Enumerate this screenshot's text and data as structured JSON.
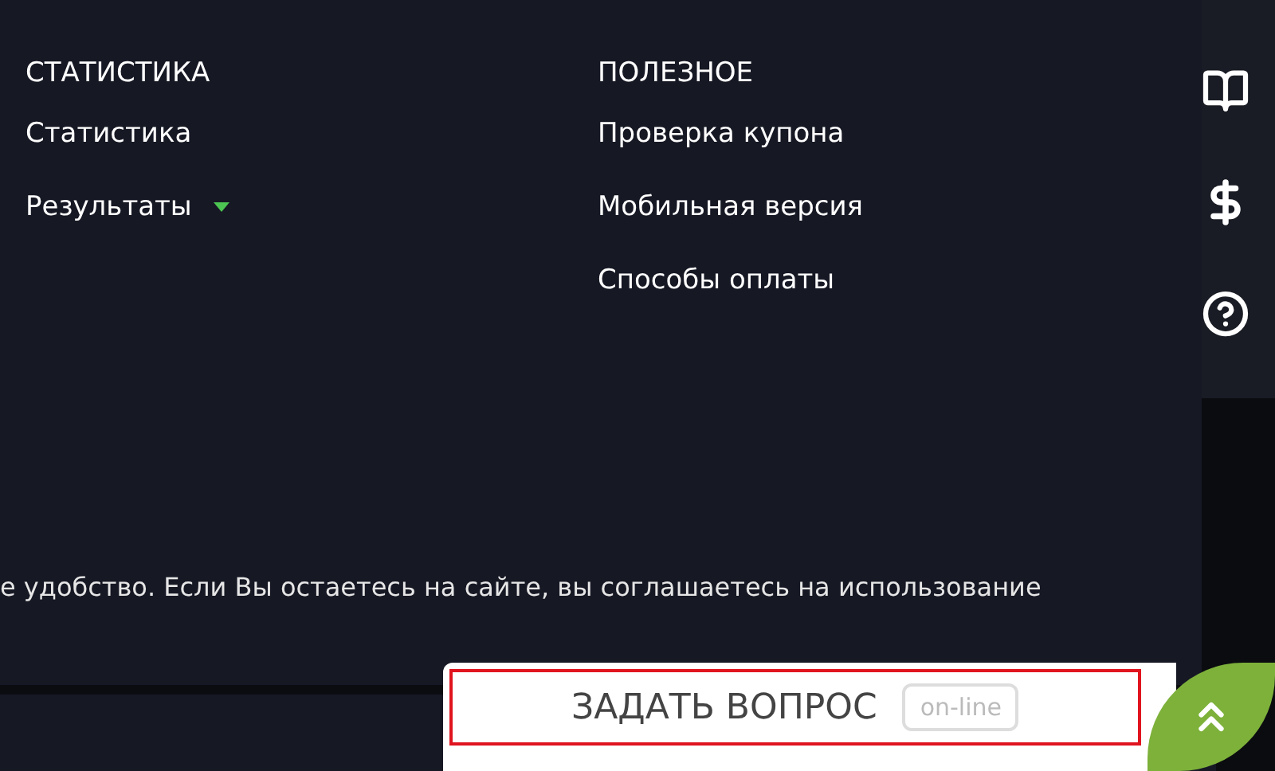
{
  "footer_columns": [
    {
      "heading": "СТАТИСТИКА",
      "links": [
        {
          "label": "Статистика",
          "kind": "plain"
        },
        {
          "label": "Результаты",
          "kind": "dropdown"
        }
      ]
    },
    {
      "heading": "ПОЛЕЗНОЕ",
      "links": [
        {
          "label": "Проверка купона",
          "kind": "plain"
        },
        {
          "label": "Мобильная версия",
          "kind": "plain"
        },
        {
          "label": "Способы оплаты",
          "kind": "plain"
        }
      ]
    }
  ],
  "side_icons": [
    {
      "kind": "book"
    },
    {
      "kind": "dollar"
    },
    {
      "kind": "help"
    }
  ],
  "cookie_notice": "е удобство. Если Вы остаетесь на сайте, вы соглашаетесь на использование",
  "chat_widget": {
    "label": "ЗАДАТЬ ВОПРОС",
    "status": "on-line"
  }
}
